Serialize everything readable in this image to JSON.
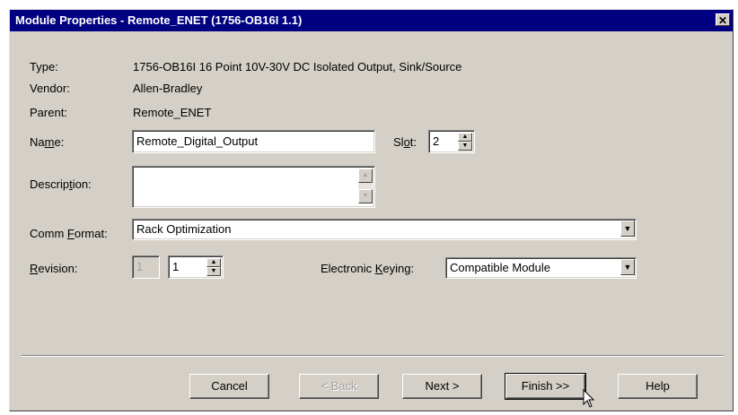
{
  "window": {
    "title": "Module Properties - Remote_ENET (1756-OB16I 1.1)",
    "close_glyph": "✕"
  },
  "info": {
    "type_label": "Type:",
    "type_value": "1756-OB16I 16 Point 10V-30V DC Isolated Output, Sink/Source",
    "vendor_label": "Vendor:",
    "vendor_value": "Allen-Bradley",
    "parent_label": "Parent:",
    "parent_value": "Remote_ENET"
  },
  "form": {
    "name_label_pre": "Na",
    "name_label_u": "m",
    "name_label_post": "e:",
    "name_value": "Remote_Digital_Output",
    "slot_label_pre": "Sl",
    "slot_label_u": "o",
    "slot_label_post": "t:",
    "slot_value": "2",
    "description_label_pre": "Descrip",
    "description_label_u": "t",
    "description_label_post": "ion:",
    "description_value": "",
    "comm_format_label_pre": "Comm ",
    "comm_format_label_u": "F",
    "comm_format_label_post": "ormat:",
    "comm_format_value": "Rack Optimization",
    "revision_label_pre": "",
    "revision_label_u": "R",
    "revision_label_post": "evision:",
    "revision_major": "1",
    "revision_minor": "1",
    "keying_label_pre": "Electronic ",
    "keying_label_u": "K",
    "keying_label_post": "eying:",
    "keying_value": "Compatible Module"
  },
  "buttons": {
    "cancel": "Cancel",
    "back": "< Back",
    "next": "Next >",
    "finish": "Finish >>",
    "help": "Help"
  }
}
